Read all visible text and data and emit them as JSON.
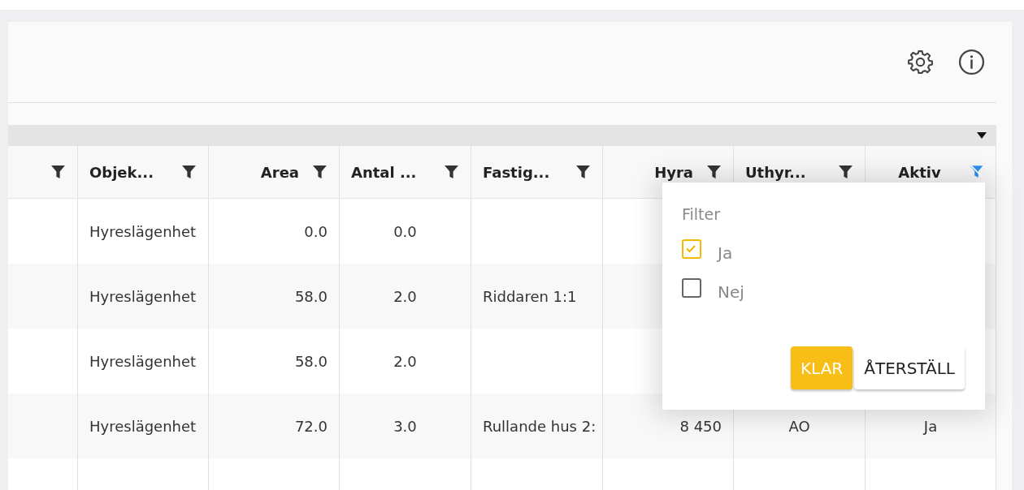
{
  "toolbar": {
    "icons": [
      {
        "kind": "settings"
      },
      {
        "kind": "info"
      }
    ]
  },
  "group_bar": {
    "expanded": true
  },
  "table": {
    "columns": [
      {
        "filter_active": false
      },
      {
        "label": "Objek...",
        "filter_active": false
      },
      {
        "label": "Area",
        "filter_active": false
      },
      {
        "label": "Antal ...",
        "filter_active": false
      },
      {
        "label": "Fastig...",
        "filter_active": false
      },
      {
        "label": "Hyra",
        "filter_active": false
      },
      {
        "label": "Uthyr...",
        "filter_active": false
      },
      {
        "label": "Aktiv",
        "filter_active": true
      }
    ],
    "rows": [
      {
        "cells": [
          null,
          "Hyreslägenhet",
          "0.0",
          "0.0",
          null,
          null,
          null,
          null
        ]
      },
      {
        "cells": [
          null,
          "Hyreslägenhet",
          "58.0",
          "2.0",
          "Riddaren 1:1",
          null,
          null,
          null
        ]
      },
      {
        "cells": [
          null,
          "Hyreslägenhet",
          "58.0",
          "2.0",
          null,
          null,
          null,
          null
        ]
      },
      {
        "cells": [
          null,
          "Hyreslägenhet",
          "72.0",
          "3.0",
          "Rullande hus 2:",
          "8 450",
          "AO",
          "Ja"
        ]
      },
      {
        "cells": [
          null,
          null,
          null,
          null,
          null,
          null,
          null,
          null
        ]
      }
    ]
  },
  "filter_popup": {
    "title": "Filter",
    "options": [
      {
        "label": "Ja",
        "checked": true
      },
      {
        "label": "Nej",
        "checked": false
      }
    ],
    "buttons": [
      {
        "label": "KLAR",
        "kind": "primary"
      },
      {
        "label": "ÅTERSTÄLL",
        "kind": "secondary"
      }
    ]
  }
}
